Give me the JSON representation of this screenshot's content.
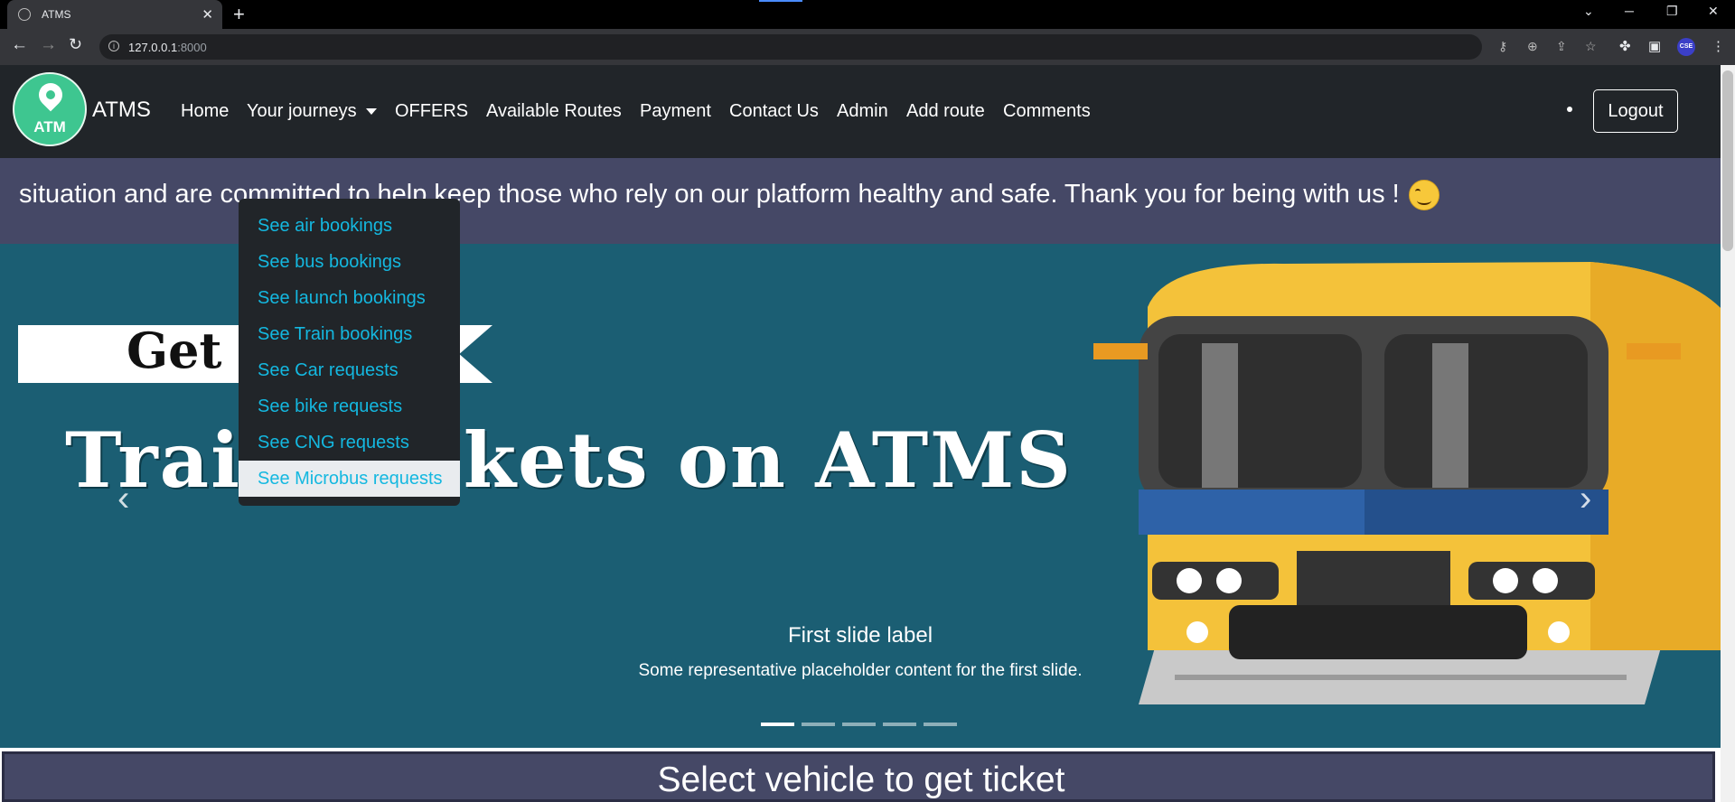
{
  "browser": {
    "tab_title": "ATMS",
    "new_tab": "+",
    "url_host": "127.0.0.1",
    "url_port": ":8000",
    "profile_label": "CSE"
  },
  "navbar": {
    "logo_text": "ATM",
    "brand": "ATMS",
    "links": [
      {
        "label": "Home"
      },
      {
        "label": "Your journeys"
      },
      {
        "label": "OFFERS"
      },
      {
        "label": "Available Routes"
      },
      {
        "label": "Payment"
      },
      {
        "label": "Contact Us"
      },
      {
        "label": "Admin"
      },
      {
        "label": "Add route"
      },
      {
        "label": "Comments"
      }
    ],
    "logout": "Logout"
  },
  "dropdown": {
    "items": [
      {
        "label": "See air bookings"
      },
      {
        "label": "See bus bookings"
      },
      {
        "label": "See launch bookings"
      },
      {
        "label": "See Train bookings"
      },
      {
        "label": "See Car requests"
      },
      {
        "label": "See bike requests"
      },
      {
        "label": "See CNG requests"
      },
      {
        "label": "See Microbus requests"
      }
    ],
    "active_index": 7
  },
  "marquee": {
    "text": "situation and are committed to help keep those who rely on our platform healthy and safe. Thank you for being with us !"
  },
  "carousel": {
    "banner_text": "Get Cheap",
    "headline": "Train Tickets on ATMS",
    "prev": "‹",
    "next": "›",
    "caption_title": "First slide label",
    "caption_text": "Some representative placeholder content for the first slide.",
    "slide_count": 5,
    "active_slide": 0
  },
  "section": {
    "title": "Select vehicle to get ticket"
  },
  "colors": {
    "navbar": "#212529",
    "marquee": "#454866",
    "carousel": "#1b5e73",
    "link_cyan": "#14b8e0"
  }
}
